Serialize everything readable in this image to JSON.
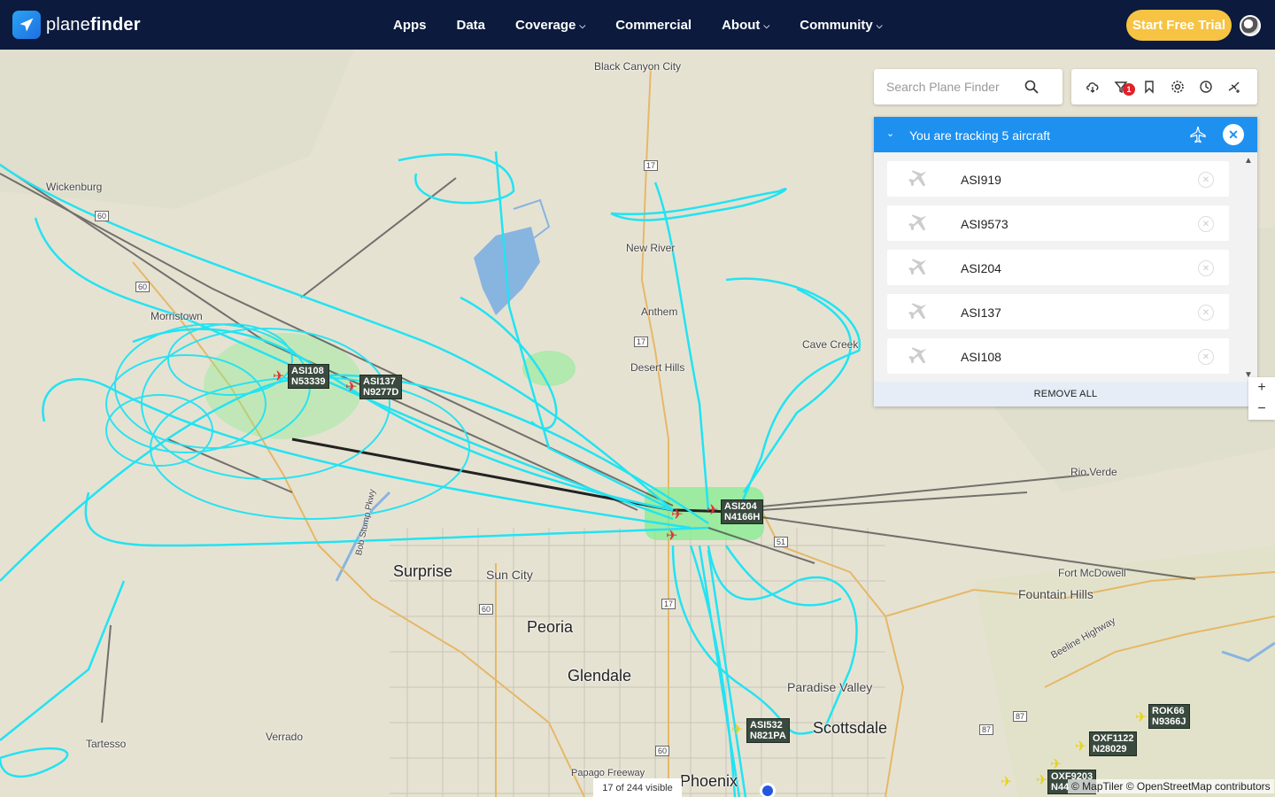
{
  "brand": {
    "name_light": "plane",
    "name_bold": "finder"
  },
  "nav": {
    "items": [
      {
        "label": "Apps",
        "has_menu": false
      },
      {
        "label": "Data",
        "has_menu": false
      },
      {
        "label": "Coverage",
        "has_menu": true
      },
      {
        "label": "Commercial",
        "has_menu": false
      },
      {
        "label": "About",
        "has_menu": true
      },
      {
        "label": "Community",
        "has_menu": true
      }
    ],
    "trial_label": "Start Free Trial"
  },
  "search": {
    "placeholder": "Search Plane Finder"
  },
  "toolbar": {
    "filter_badge": "1"
  },
  "tracking": {
    "title": "You are tracking 5 aircraft",
    "items": [
      {
        "label": "ASI919"
      },
      {
        "label": "ASI9573"
      },
      {
        "label": "ASI204"
      },
      {
        "label": "ASI137"
      },
      {
        "label": "ASI108"
      }
    ],
    "remove_all": "REMOVE ALL"
  },
  "map": {
    "places": [
      {
        "label": "Black Canyon City"
      },
      {
        "label": "Wickenburg"
      },
      {
        "label": "New River"
      },
      {
        "label": "Anthem"
      },
      {
        "label": "Morristown"
      },
      {
        "label": "Desert Hills"
      },
      {
        "label": "Cave Creek"
      },
      {
        "label": "Rio Verde"
      },
      {
        "label": "Fort McDowell"
      },
      {
        "label": "Fountain Hills"
      },
      {
        "label": "Surprise"
      },
      {
        "label": "Sun City"
      },
      {
        "label": "Peoria"
      },
      {
        "label": "Glendale"
      },
      {
        "label": "Paradise Valley"
      },
      {
        "label": "Scottsdale"
      },
      {
        "label": "Verrado"
      },
      {
        "label": "Tartesso"
      },
      {
        "label": "Phoenix"
      },
      {
        "label": "Bob Stump Pkwy"
      },
      {
        "label": "Beeline Highway"
      },
      {
        "label": "Papago Freeway"
      }
    ],
    "aircraft_tags": [
      {
        "callsign": "ASI108",
        "reg": "N53339"
      },
      {
        "callsign": "ASI137",
        "reg": "N9277D"
      },
      {
        "callsign": "ASI204",
        "reg": "N4166H"
      },
      {
        "callsign": "ASI532",
        "reg": "N821PA"
      },
      {
        "callsign": "ROK66",
        "reg": "N9366J"
      },
      {
        "callsign": "OXF1122",
        "reg": "N28029"
      },
      {
        "callsign": "OXF9203",
        "reg": "N44"
      }
    ],
    "highway_shields": [
      "17",
      "17",
      "17",
      "60",
      "60",
      "60",
      "60",
      "51",
      "87",
      "87"
    ],
    "track_color": "#22e3f2",
    "route_color": "#3b3b3b"
  },
  "footer": {
    "visible_count": "17 of 244 visible",
    "attribution": "© MapTiler © OpenStreetMap contributors"
  },
  "zoom": {
    "in": "+",
    "out": "−"
  }
}
